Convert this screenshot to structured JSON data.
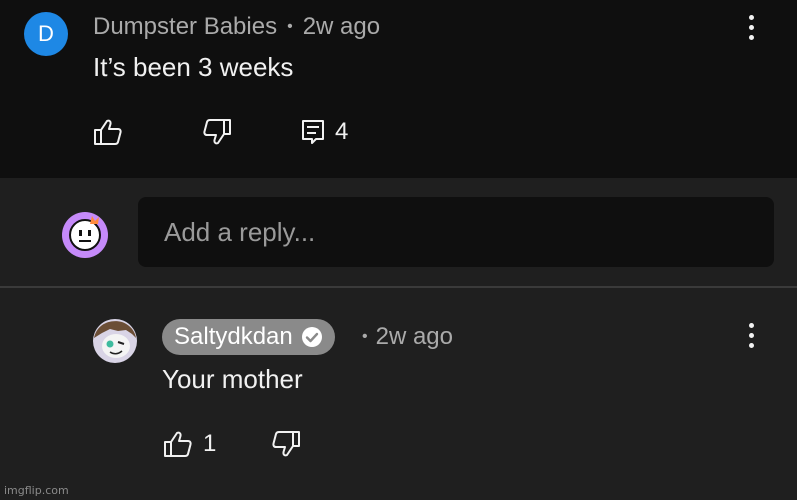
{
  "comment": {
    "avatar_letter": "D",
    "avatar_color": "#1e88e5",
    "author": "Dumpster Babies",
    "separator": "•",
    "time": "2w ago",
    "text": "It’s been 3 weeks",
    "reply_count": "4",
    "icons": [
      "like-icon",
      "dislike-icon",
      "comment-icon",
      "more-vert-icon"
    ]
  },
  "reply_input": {
    "placeholder": "Add a reply..."
  },
  "reply": {
    "author": "Saltydkdan",
    "separator": "•",
    "time": "2w ago",
    "text": "Your mother",
    "like_count": "1",
    "icons": [
      "verified-icon",
      "like-icon",
      "dislike-icon",
      "more-vert-icon"
    ]
  },
  "watermark": "imgflip.com",
  "colors": {
    "background_top": "#0f0f0f",
    "background_bottom": "#1f1f1f",
    "author_pill": "#8a8a8a",
    "secondary_text": "#aaaaaa",
    "user_avatar": "#c58af9"
  }
}
